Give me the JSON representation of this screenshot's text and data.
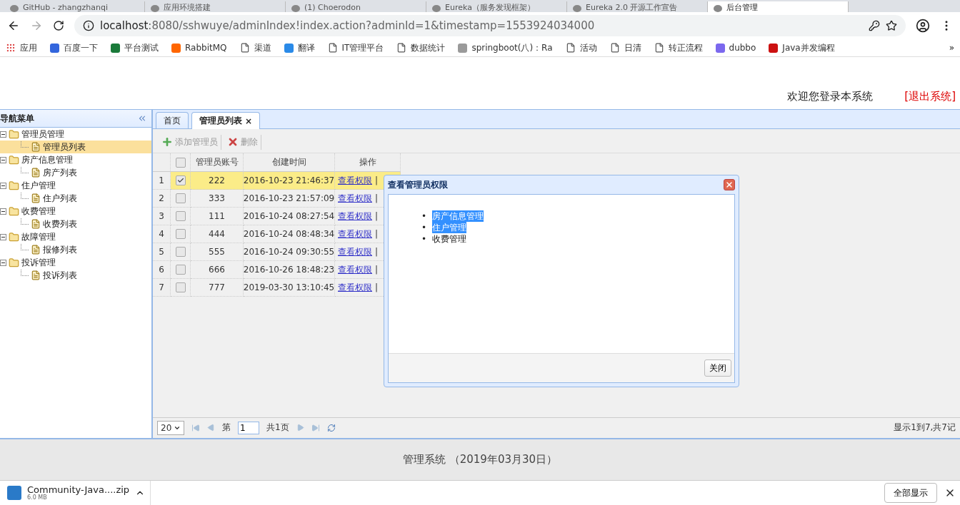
{
  "browser": {
    "tabs": [
      {
        "title": "GitHub - zhangzhanqi",
        "selected": false
      },
      {
        "title": "应用环境搭建",
        "selected": false
      },
      {
        "title": "(1) Choerodon",
        "selected": false
      },
      {
        "title": "Eureka（服务发现框架）",
        "selected": false
      },
      {
        "title": "Eureka 2.0 开源工作宣告",
        "selected": false
      },
      {
        "title": "后台管理",
        "selected": true
      }
    ],
    "url_host": "localhost",
    "url_rest": ":8080/sshwuye/adminIndex!index.action?adminId=1&timestamp=1553924034000",
    "bookmarks": [
      {
        "label": "应用",
        "kind": "apps"
      },
      {
        "label": "百度一下",
        "kind": "badge",
        "color": "#3366dd"
      },
      {
        "label": "平台测试",
        "kind": "badge",
        "color": "#1a7a3a"
      },
      {
        "label": "RabbitMQ",
        "kind": "badge",
        "color": "#ff6600"
      },
      {
        "label": "渠道",
        "kind": "page"
      },
      {
        "label": "翻译",
        "kind": "badge",
        "color": "#2a8ae8"
      },
      {
        "label": "IT管理平台",
        "kind": "page"
      },
      {
        "label": "数据统计",
        "kind": "page"
      },
      {
        "label": "springboot(八)：Ra",
        "kind": "badge",
        "color": "#9a9a9a"
      },
      {
        "label": "活动",
        "kind": "page"
      },
      {
        "label": "日清",
        "kind": "page"
      },
      {
        "label": "转正流程",
        "kind": "page"
      },
      {
        "label": "dubbo",
        "kind": "badge",
        "color": "#7b68ee"
      },
      {
        "label": "Java并发编程",
        "kind": "badge",
        "color": "#cc1111"
      }
    ],
    "more": "»"
  },
  "header": {
    "welcome": "欢迎您登录本系统",
    "logout": "[退出系统]"
  },
  "sidebar": {
    "title": "导航菜单",
    "items": [
      {
        "label": "管理员管理",
        "expanded": true,
        "children": [
          {
            "label": "管理员列表",
            "selected": true
          }
        ]
      },
      {
        "label": "房产信息管理",
        "expanded": true,
        "children": [
          {
            "label": "房产列表",
            "selected": false
          }
        ]
      },
      {
        "label": "住户管理",
        "expanded": true,
        "children": [
          {
            "label": "住户列表",
            "selected": false
          }
        ]
      },
      {
        "label": "收费管理",
        "expanded": true,
        "children": [
          {
            "label": "收费列表",
            "selected": false
          }
        ]
      },
      {
        "label": "故障管理",
        "expanded": true,
        "children": [
          {
            "label": "报修列表",
            "selected": false
          }
        ]
      },
      {
        "label": "投诉管理",
        "expanded": true,
        "children": [
          {
            "label": "投诉列表",
            "selected": false
          }
        ]
      }
    ]
  },
  "tabs": [
    {
      "label": "首页",
      "selected": false,
      "closable": false
    },
    {
      "label": "管理员列表",
      "selected": true,
      "closable": true
    }
  ],
  "close_mark": "×",
  "toolbar": [
    {
      "label": "添加管理员",
      "kind": "add"
    },
    {
      "label": "删除",
      "kind": "delete"
    }
  ],
  "table": {
    "columns": [
      "管理员账号",
      "创建时间",
      "操作"
    ],
    "header_checked": false,
    "rows": [
      {
        "index": "1",
        "checked": true,
        "selected": true,
        "account": "222",
        "created": "2016-10-23 21:46:37",
        "action": "查看权限",
        "sep": "|"
      },
      {
        "index": "2",
        "checked": false,
        "selected": false,
        "account": "333",
        "created": "2016-10-23 21:57:09",
        "action": "查看权限",
        "sep": "|"
      },
      {
        "index": "3",
        "checked": false,
        "selected": false,
        "account": "111",
        "created": "2016-10-24 08:27:54",
        "action": "查看权限",
        "sep": "|"
      },
      {
        "index": "4",
        "checked": false,
        "selected": false,
        "account": "444",
        "created": "2016-10-24 08:48:34",
        "action": "查看权限",
        "sep": "|"
      },
      {
        "index": "5",
        "checked": false,
        "selected": false,
        "account": "555",
        "created": "2016-10-24 09:30:55",
        "action": "查看权限",
        "sep": "|"
      },
      {
        "index": "6",
        "checked": false,
        "selected": false,
        "account": "666",
        "created": "2016-10-26 18:48:23",
        "action": "查看权限",
        "sep": "|"
      },
      {
        "index": "7",
        "checked": false,
        "selected": false,
        "account": "777",
        "created": "2019-03-30 13:10:45",
        "action": "查看权限",
        "sep": "|"
      }
    ]
  },
  "pager": {
    "page_size": "20",
    "page_prefix": "第",
    "page": "1",
    "page_total": "共1页",
    "info": "显示1到7,共7记"
  },
  "dialog": {
    "title": "查看管理员权限",
    "bullet": "•",
    "items": [
      {
        "label": "房产信息管理",
        "highlighted": true
      },
      {
        "label": "住户管理",
        "highlighted": true
      },
      {
        "label": "收费管理",
        "highlighted": false
      }
    ],
    "button": "关闭"
  },
  "footer": "管理系统 （2019年03月30日）",
  "downloads": {
    "file": "Community-Java....zip",
    "size": "6.0 MB",
    "show_all": "全部显示"
  }
}
